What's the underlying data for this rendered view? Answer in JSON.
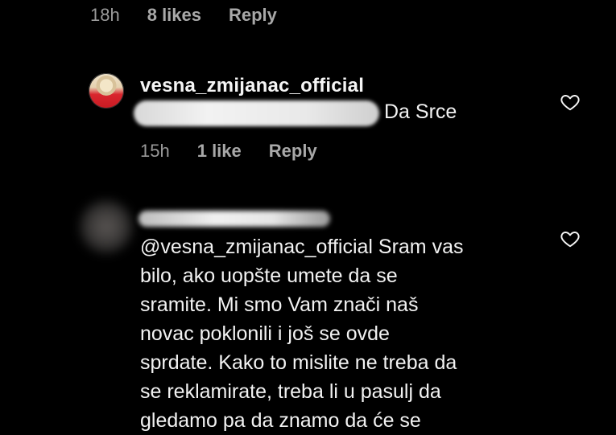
{
  "top_meta": {
    "time": "18h",
    "likes": "8 likes",
    "reply": "Reply"
  },
  "comment1": {
    "username": "vesna_zmijanac_official",
    "text": "Da Srce",
    "time": "15h",
    "likes": "1 like",
    "reply": "Reply"
  },
  "comment2": {
    "text_lines": [
      "@vesna_zmijanac_official Sram vas",
      "bilo, ako uopšte umete da se",
      "sramite. Mi smo Vam znači naš",
      "novac poklonili i još se ovde",
      "sprdate. Kako to mislite ne treba da",
      "se reklamirate, treba li u pasulj da",
      "gledamo pa da znamo da će se"
    ]
  },
  "icons": {
    "heart": "heart-outline-icon",
    "avatar": "avatar"
  },
  "colors": {
    "background": "#000000",
    "text": "#f5f5f5",
    "muted": "#a8a8a8"
  }
}
